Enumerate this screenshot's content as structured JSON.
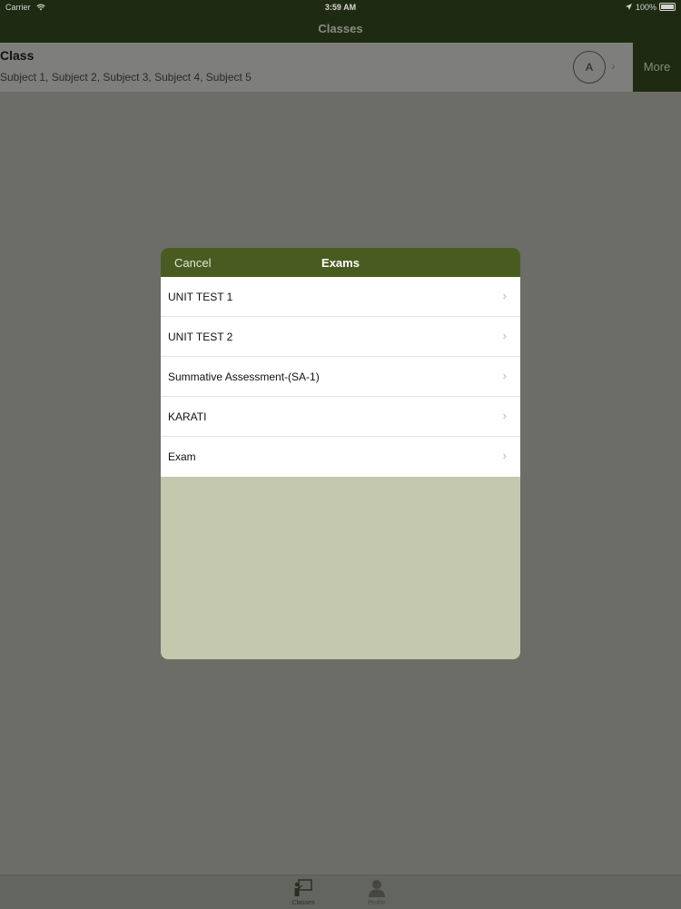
{
  "status_bar": {
    "carrier": "Carrier",
    "time": "3:59 AM",
    "battery": "100%"
  },
  "nav": {
    "title": "Classes"
  },
  "class_row": {
    "title": "Class",
    "subjects": "Subject 1, Subject 2, Subject 3, Subject 4, Subject 5",
    "avatar_letter": "A",
    "more_label": "More"
  },
  "modal": {
    "cancel_label": "Cancel",
    "title": "Exams",
    "items": [
      {
        "label": "UNIT TEST 1"
      },
      {
        "label": "UNIT TEST 2"
      },
      {
        "label": "Summative Assessment-(SA-1)"
      },
      {
        "label": "KARATI"
      },
      {
        "label": "Exam"
      }
    ]
  },
  "tabs": [
    {
      "label": "Classes",
      "icon": "classroom-icon"
    },
    {
      "label": "Profile",
      "icon": "person-icon"
    }
  ],
  "colors": {
    "nav_bg": "#1f2a13",
    "modal_header": "#4a5b22",
    "modal_body": "#c4c8ad",
    "overlay": "#6b6d66"
  }
}
